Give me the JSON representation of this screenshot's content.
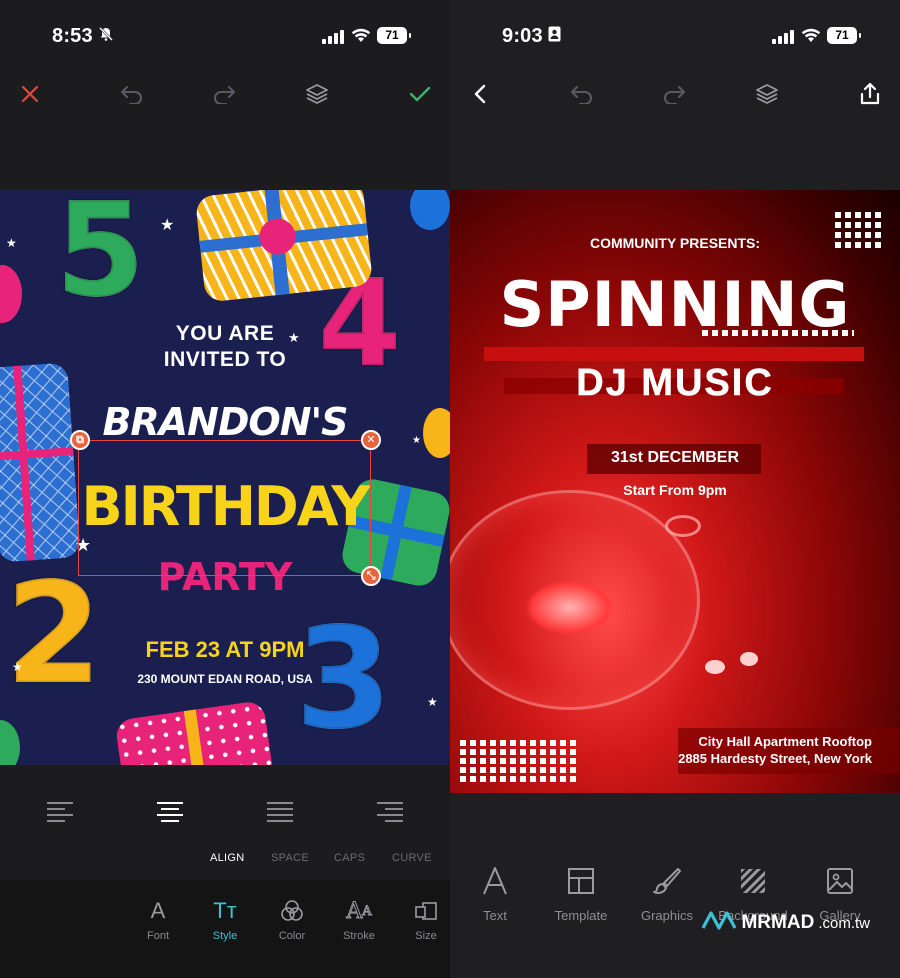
{
  "left": {
    "status": {
      "time": "8:53",
      "battery": "71"
    },
    "toolbar": {
      "close": "close-icon",
      "undo": "undo-icon",
      "redo": "redo-icon",
      "layers": "layers-icon",
      "confirm": "check-icon"
    },
    "poster": {
      "line1": "YOU ARE",
      "line2": "INVITED TO",
      "name": "BRANDON'S",
      "title": "BIRTHDAY",
      "subtitle": "PARTY",
      "date": "FEB 23 AT 9PM",
      "address": "230 MOUNT EDAN ROAD, USA"
    },
    "text_options": [
      "ALIGN",
      "SPACE",
      "CAPS",
      "CURVE"
    ],
    "tabs": [
      {
        "label": "Font",
        "icon": "A"
      },
      {
        "label": "Style",
        "icon": "Tт"
      },
      {
        "label": "Color",
        "icon": "color-icon"
      },
      {
        "label": "Stroke",
        "icon": "stroke-icon"
      },
      {
        "label": "Size",
        "icon": "size-icon"
      }
    ]
  },
  "right": {
    "status": {
      "time": "9:03",
      "battery": "71"
    },
    "poster": {
      "presents": "COMMUNITY PRESENTS:",
      "title": "SPINNING",
      "subtitle": "DJ MUSIC",
      "date": "31st DECEMBER",
      "start": "Start From 9pm",
      "venue1": "City Hall Apartment Rooftop",
      "venue2": "2885 Hardesty Street, New York"
    },
    "tabs": [
      {
        "label": "Text"
      },
      {
        "label": "Template"
      },
      {
        "label": "Graphics"
      },
      {
        "label": "Background"
      },
      {
        "label": "Gallery"
      }
    ]
  },
  "watermark": {
    "brand": "MRMAD",
    "suffix": ".com.tw"
  },
  "colors": {
    "accent": "#3ec1d3",
    "close": "#e8453c",
    "confirm": "#3fb06f",
    "poster_bg": "#1b1f4f",
    "dj_red": "#c80f0f"
  }
}
